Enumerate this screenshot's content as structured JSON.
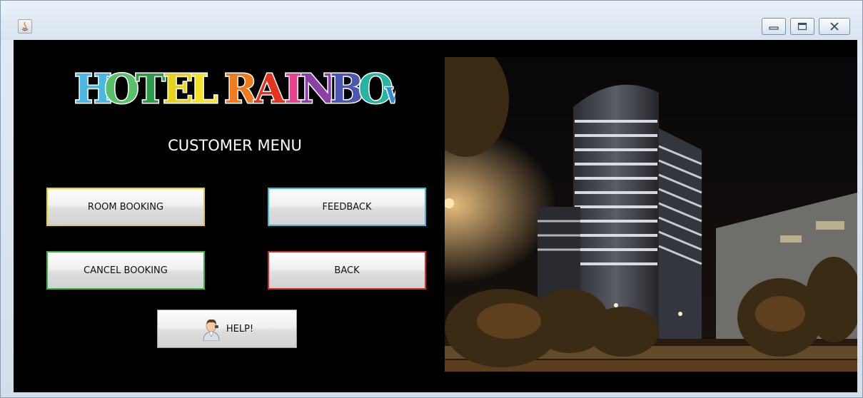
{
  "logo": {
    "text": "HOTEL RAINBOW"
  },
  "menu": {
    "title": "CUSTOMER MENU"
  },
  "buttons": {
    "room_booking": "ROOM BOOKING",
    "feedback": "FEEDBACK",
    "cancel_booking": "CANCEL BOOKING",
    "back": "BACK",
    "help": "HELP!"
  },
  "icons": {
    "app": "java-app-icon",
    "help": "person-help-icon",
    "minimize": "minimize-icon",
    "maximize": "maximize-icon",
    "close": "close-icon"
  },
  "colors": {
    "background": "#000000",
    "room_booking_border": "#e6cf2a",
    "feedback_border": "#3cb8d0",
    "cancel_booking_border": "#36b545",
    "back_border": "#d12b2b"
  }
}
